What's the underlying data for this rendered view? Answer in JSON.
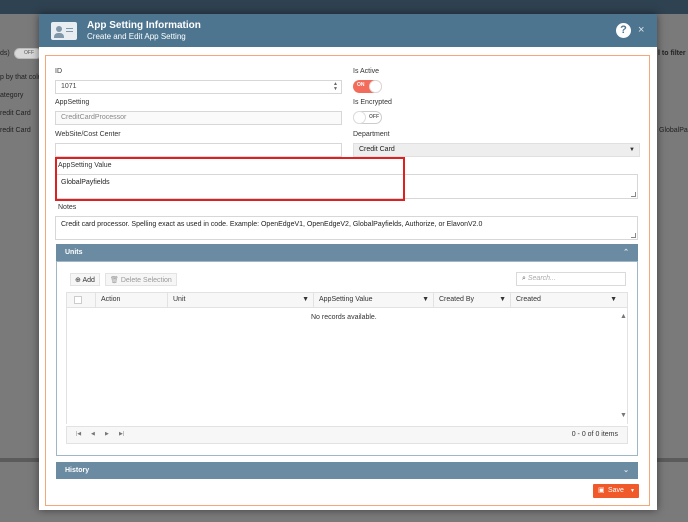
{
  "background": {
    "left_texts": [
      "ds)",
      "p by that colu",
      "ategory",
      "redit Card",
      "redit Card"
    ],
    "right_texts": [
      "l to filter",
      "GlobalPa"
    ],
    "toggle_label": "OFF"
  },
  "modal": {
    "title": "App Setting Information",
    "subtitle": "Create and Edit App Setting",
    "help_label": "?",
    "close_label": "×"
  },
  "form": {
    "id_label": "ID",
    "id_value": "1071",
    "is_active_label": "Is Active",
    "is_active_state": "ON",
    "appsetting_label": "AppSetting",
    "appsetting_value": "CreditCardProcessor",
    "is_encrypted_label": "Is Encrypted",
    "is_encrypted_state": "OFF",
    "website_label": "WebSite/Cost Center",
    "website_value": "",
    "department_label": "Department",
    "department_value": "Credit Card",
    "appsetting_value_label": "AppSetting Value",
    "appsetting_value_value": "GlobalPayfields",
    "notes_label": "Notes",
    "notes_value": "Credit card processor. Spelling exact as used in code. Example: OpenEdgeV1, OpenEdgeV2, GlobalPayfields, Authorize, or ElavonV2.0"
  },
  "units": {
    "title": "Units",
    "add_label": "Add",
    "delete_label": "Delete Selection",
    "search_placeholder": "Search...",
    "columns": [
      "Action",
      "Unit",
      "AppSetting Value",
      "Created By",
      "Created"
    ],
    "empty_message": "No records available.",
    "pager_info": "0 - 0 of 0 items"
  },
  "history": {
    "title": "History"
  },
  "footer": {
    "save_label": "Save"
  },
  "colors": {
    "header": "#4d7590",
    "accent": "#f0592a",
    "toggle_on": "#f26b5b",
    "highlight": "#e02020"
  }
}
